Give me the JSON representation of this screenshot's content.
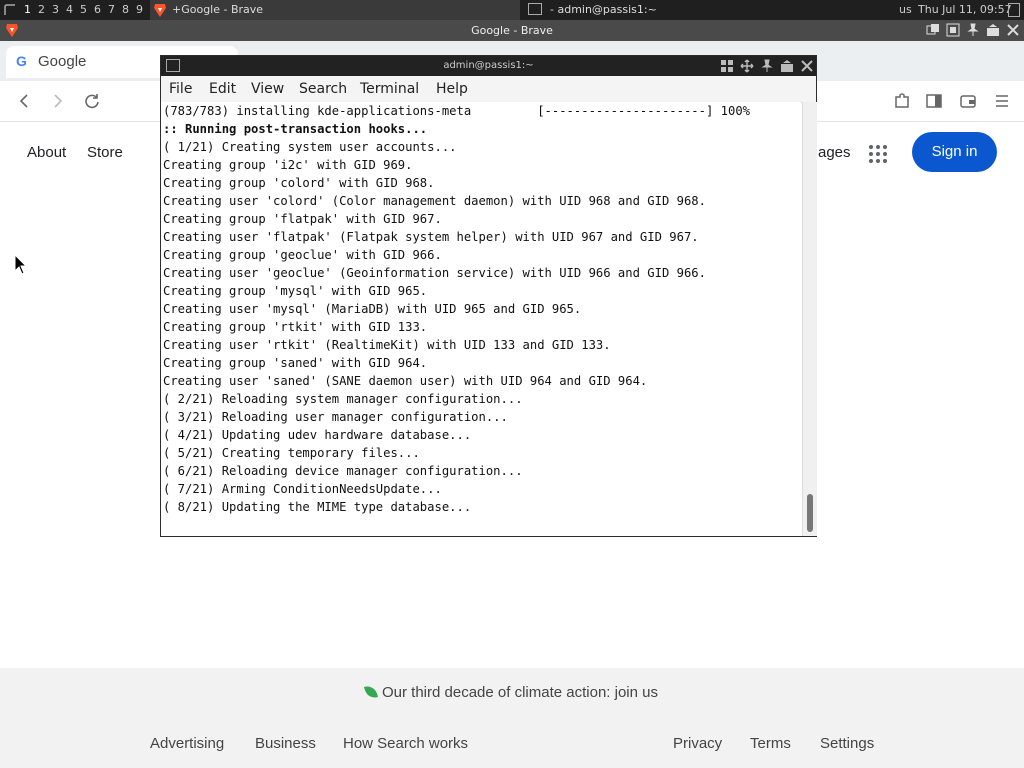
{
  "panel": {
    "workspaces": [
      "1",
      "2",
      "3",
      "4",
      "5",
      "6",
      "7",
      "8",
      "9"
    ],
    "tasks": [
      {
        "title": "Google - Brave"
      },
      {
        "title": "admin@passis1:~"
      }
    ],
    "keyboard_layout": "us",
    "clock": "Thu Jul 11, 09:57"
  },
  "brave_window": {
    "title": "Google - Brave"
  },
  "browser": {
    "tab_title": "Google",
    "tab_icon_letter": "G"
  },
  "google": {
    "left_links": [
      "About",
      "Store"
    ],
    "right_links_partial": "ages",
    "sign_in": "Sign in",
    "climate_text": "Our third decade of climate action: join us",
    "footer_left": [
      "Advertising",
      "Business",
      "How Search works"
    ],
    "footer_right": [
      "Privacy",
      "Terms",
      "Settings"
    ]
  },
  "terminal": {
    "title": "admin@passis1:~",
    "menu": [
      "File",
      "Edit",
      "View",
      "Search",
      "Terminal",
      "Help"
    ],
    "lines": [
      "(783/783) installing kde-applications-meta         [----------------------] 100%",
      ":: Running post-transaction hooks...",
      "( 1/21) Creating system user accounts...",
      "Creating group 'i2c' with GID 969.",
      "Creating group 'colord' with GID 968.",
      "Creating user 'colord' (Color management daemon) with UID 968 and GID 968.",
      "Creating group 'flatpak' with GID 967.",
      "Creating user 'flatpak' (Flatpak system helper) with UID 967 and GID 967.",
      "Creating group 'geoclue' with GID 966.",
      "Creating user 'geoclue' (Geoinformation service) with UID 966 and GID 966.",
      "Creating group 'mysql' with GID 965.",
      "Creating user 'mysql' (MariaDB) with UID 965 and GID 965.",
      "Creating group 'rtkit' with GID 133.",
      "Creating user 'rtkit' (RealtimeKit) with UID 133 and GID 133.",
      "Creating group 'saned' with GID 964.",
      "Creating user 'saned' (SANE daemon user) with UID 964 and GID 964.",
      "( 2/21) Reloading system manager configuration...",
      "( 3/21) Reloading user manager configuration...",
      "( 4/21) Updating udev hardware database...",
      "( 5/21) Creating temporary files...",
      "( 6/21) Reloading device manager configuration...",
      "( 7/21) Arming ConditionNeedsUpdate...",
      "( 8/21) Updating the MIME type database..."
    ]
  }
}
